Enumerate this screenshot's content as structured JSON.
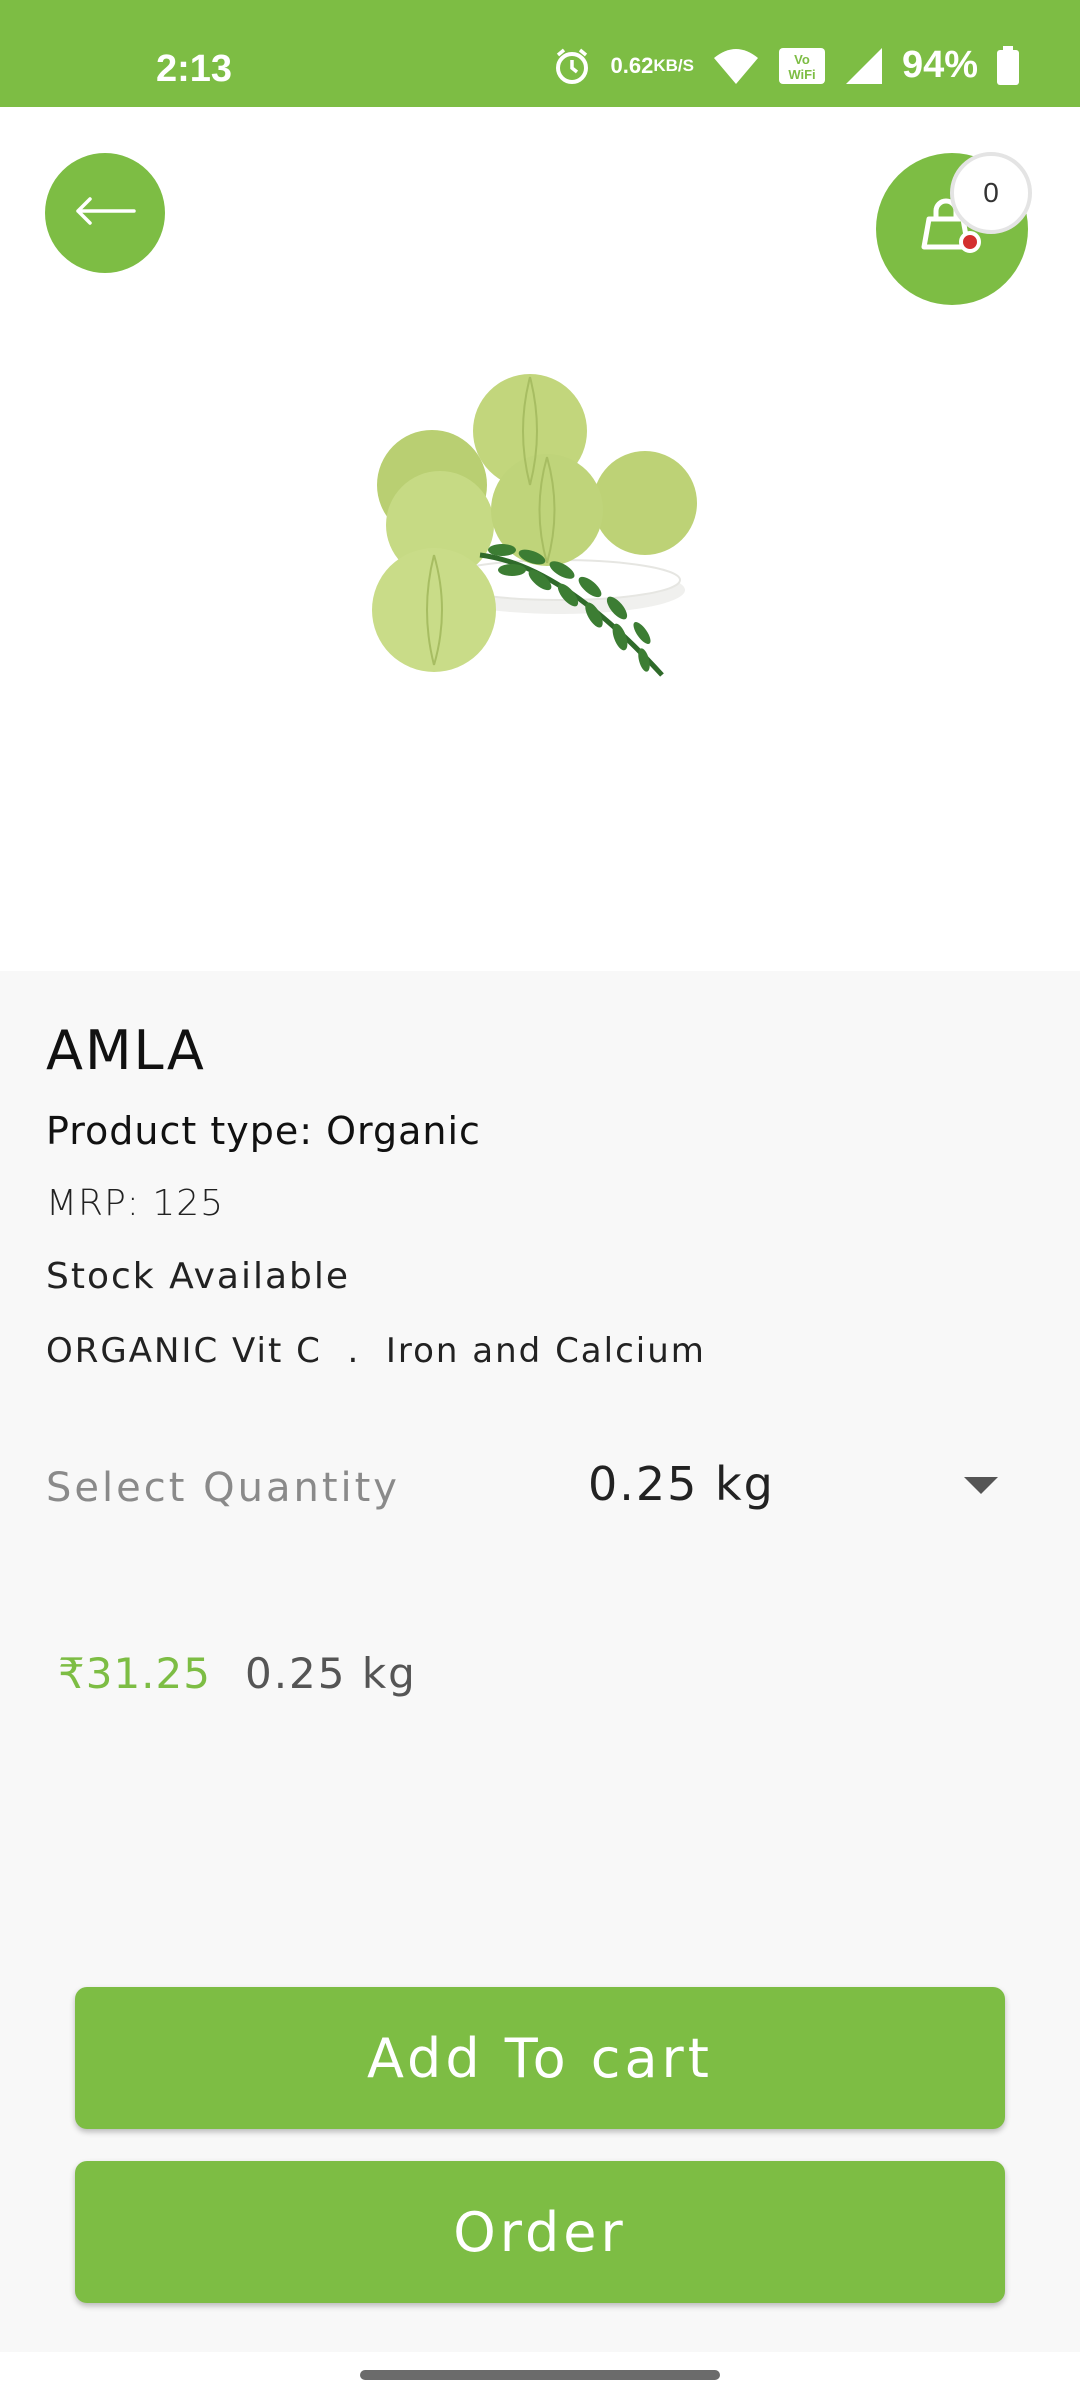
{
  "status_bar": {
    "time": "2:13",
    "net_speed_value": "0.62",
    "net_speed_unit": "KB/S",
    "battery": "94%",
    "icons": [
      "alarm-icon",
      "wifi-icon",
      "vowifi-icon",
      "signal-icon",
      "battery-icon"
    ]
  },
  "header": {
    "back_icon": "arrow-left-icon",
    "cart_icon": "shopping-bag-icon",
    "cart_count": "0"
  },
  "product": {
    "name": "AMLA",
    "type": "Product type: Organic",
    "mrp": "MRP: 125",
    "stock": "Stock Available",
    "description": "ORGANIC Vit C  .  Iron and Calcium",
    "quantity_label": "Select Quantity",
    "quantity_selected": "0.25 kg",
    "price": "₹31.25",
    "price_unit": "0.25 kg"
  },
  "actions": {
    "add_to_cart": "Add To cart",
    "order": "Order"
  },
  "colors": {
    "brand_green": "#7dbd44",
    "cart_dot": "#d32f2f"
  }
}
